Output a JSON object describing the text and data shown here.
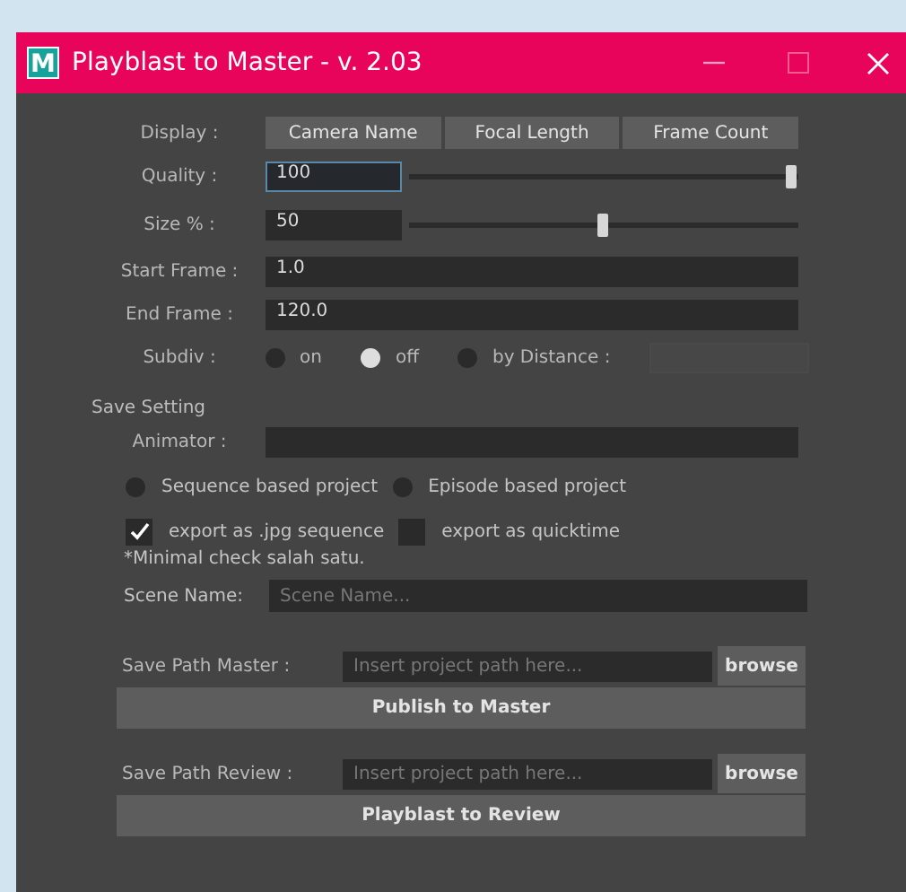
{
  "window": {
    "logo_letter": "M",
    "title": "Playblast to Master - v. 2.03"
  },
  "display": {
    "label": "Display :",
    "buttons": [
      "Camera Name",
      "Focal Length",
      "Frame Count"
    ]
  },
  "quality": {
    "label": "Quality :",
    "value": "100",
    "focused": true,
    "level": 1
  },
  "size": {
    "label": "Size % :",
    "value": "50",
    "focused": false,
    "level": 0.5
  },
  "start_frame": {
    "label": "Start Frame :",
    "value": "1.0"
  },
  "end_frame": {
    "label": "End Frame :",
    "value": "120.0"
  },
  "subdiv": {
    "label": "Subdiv :",
    "options": [
      {
        "label": "on",
        "selected": false
      },
      {
        "label": "off",
        "selected": true
      },
      {
        "label": "by Distance :",
        "selected": false
      }
    ]
  },
  "save_setting": {
    "title": "Save Setting",
    "animator_label": "Animator :",
    "project_types": [
      {
        "label": "Sequence based project",
        "selected": false
      },
      {
        "label": "Episode based project",
        "selected": false
      }
    ],
    "exports": [
      {
        "label": "export as .jpg sequence",
        "checked": true
      },
      {
        "label": "export as quicktime",
        "checked": false
      }
    ],
    "note": "*Minimal check salah satu.",
    "scene_name": {
      "label": "Scene Name:",
      "placeholder": "Scene Name..."
    }
  },
  "paths": [
    {
      "label": "Save Path Master :",
      "placeholder": "Insert project path here...",
      "browse": "browse",
      "action": "Publish to Master"
    },
    {
      "label": "Save Path Review :",
      "placeholder": "Insert project path here...",
      "browse": "browse",
      "action": "Playblast to Review"
    }
  ]
}
